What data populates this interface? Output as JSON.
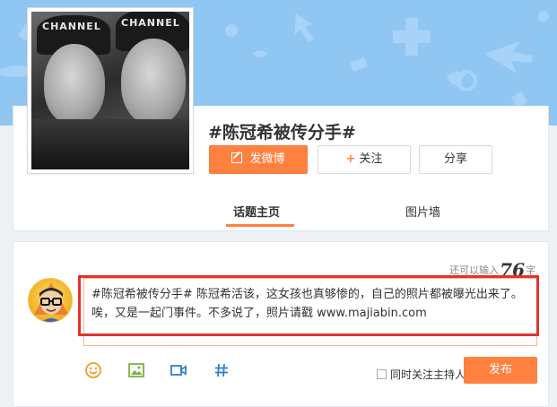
{
  "topic": {
    "title": "#陈冠希被传分手#",
    "cover_hat_text_1": "CHANNEL",
    "cover_hat_text_2": "CHANNEL"
  },
  "actions": {
    "post_label": "发微博",
    "follow_label": "关注",
    "share_label": "分享"
  },
  "tabs": [
    {
      "label": "话题主页",
      "active": true
    },
    {
      "label": "图片墙",
      "active": false
    }
  ],
  "composer": {
    "remaining_prefix": "还可以输入",
    "remaining_count": "76",
    "remaining_suffix": "字",
    "text": "#陈冠希被传分手# 陈冠希活该，这女孩也真够惨的，自己的照片都被曝光出来了。唉，又是一起门事件。不多说了，照片请戳 www.majiabin.com",
    "toolbar": [
      "emoji-icon",
      "image-icon",
      "video-icon",
      "hashtag-icon"
    ],
    "follow_host_label": "同时关注主持人",
    "follow_host_checked": false,
    "publish_label": "发布"
  },
  "colors": {
    "accent": "#ff8140",
    "highlight_box": "#e1322f",
    "banner": "#8fc6f2",
    "icon_orange": "#f59a23",
    "icon_green": "#7cb342",
    "icon_blue": "#2f7fd1"
  }
}
